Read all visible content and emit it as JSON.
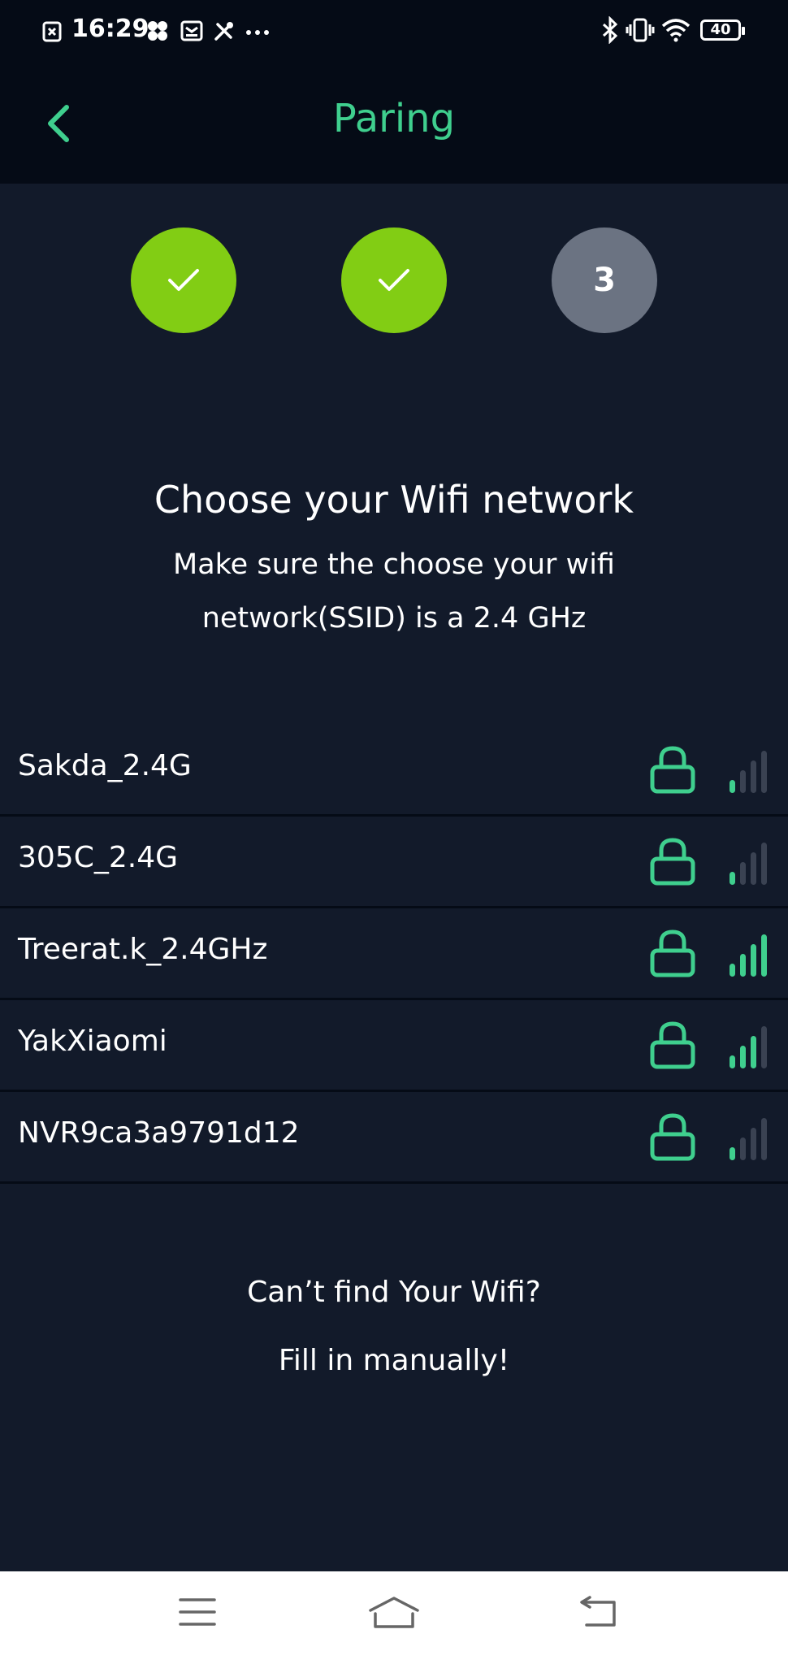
{
  "status_bar": {
    "time": "16:29",
    "battery": "40",
    "icons": [
      "image-close-icon",
      "fan-icon",
      "mail-icon",
      "tools-icon",
      "more-dots-icon",
      "bluetooth-icon",
      "vibrate-icon",
      "wifi-icon",
      "battery-icon"
    ]
  },
  "header": {
    "title": "Paring",
    "back_icon": "chevron-left-icon"
  },
  "steps": [
    {
      "state": "done",
      "icon": "check-icon"
    },
    {
      "state": "done",
      "icon": "check-icon"
    },
    {
      "state": "current",
      "label": "3"
    }
  ],
  "main": {
    "heading": "Choose your Wifi network",
    "subtitle": "Make sure the choose your wifi network(SSID) is a 2.4 GHz"
  },
  "networks": [
    {
      "ssid": "Sakda_2.4G",
      "locked": true,
      "signal_bars": 1
    },
    {
      "ssid": "305C_2.4G",
      "locked": true,
      "signal_bars": 1
    },
    {
      "ssid": "Treerat.k_2.4GHz",
      "locked": true,
      "signal_bars": 4
    },
    {
      "ssid": "YakXiaomi",
      "locked": true,
      "signal_bars": 3
    },
    {
      "ssid": "NVR9ca3a9791d12",
      "locked": true,
      "signal_bars": 1
    }
  ],
  "footer": {
    "cant_find": "Can’t find Your Wifi?",
    "fill_manually": "Fill in manually!"
  },
  "nav_bar": {
    "icons": [
      "menu-icon",
      "home-icon",
      "back-icon"
    ]
  },
  "colors": {
    "accent": "#3fcf8e",
    "step_done": "#82cd14",
    "step_todo": "#6b7382",
    "background": "#121a2a",
    "header_bg": "#050b16",
    "signal_off": "#3a4252"
  }
}
